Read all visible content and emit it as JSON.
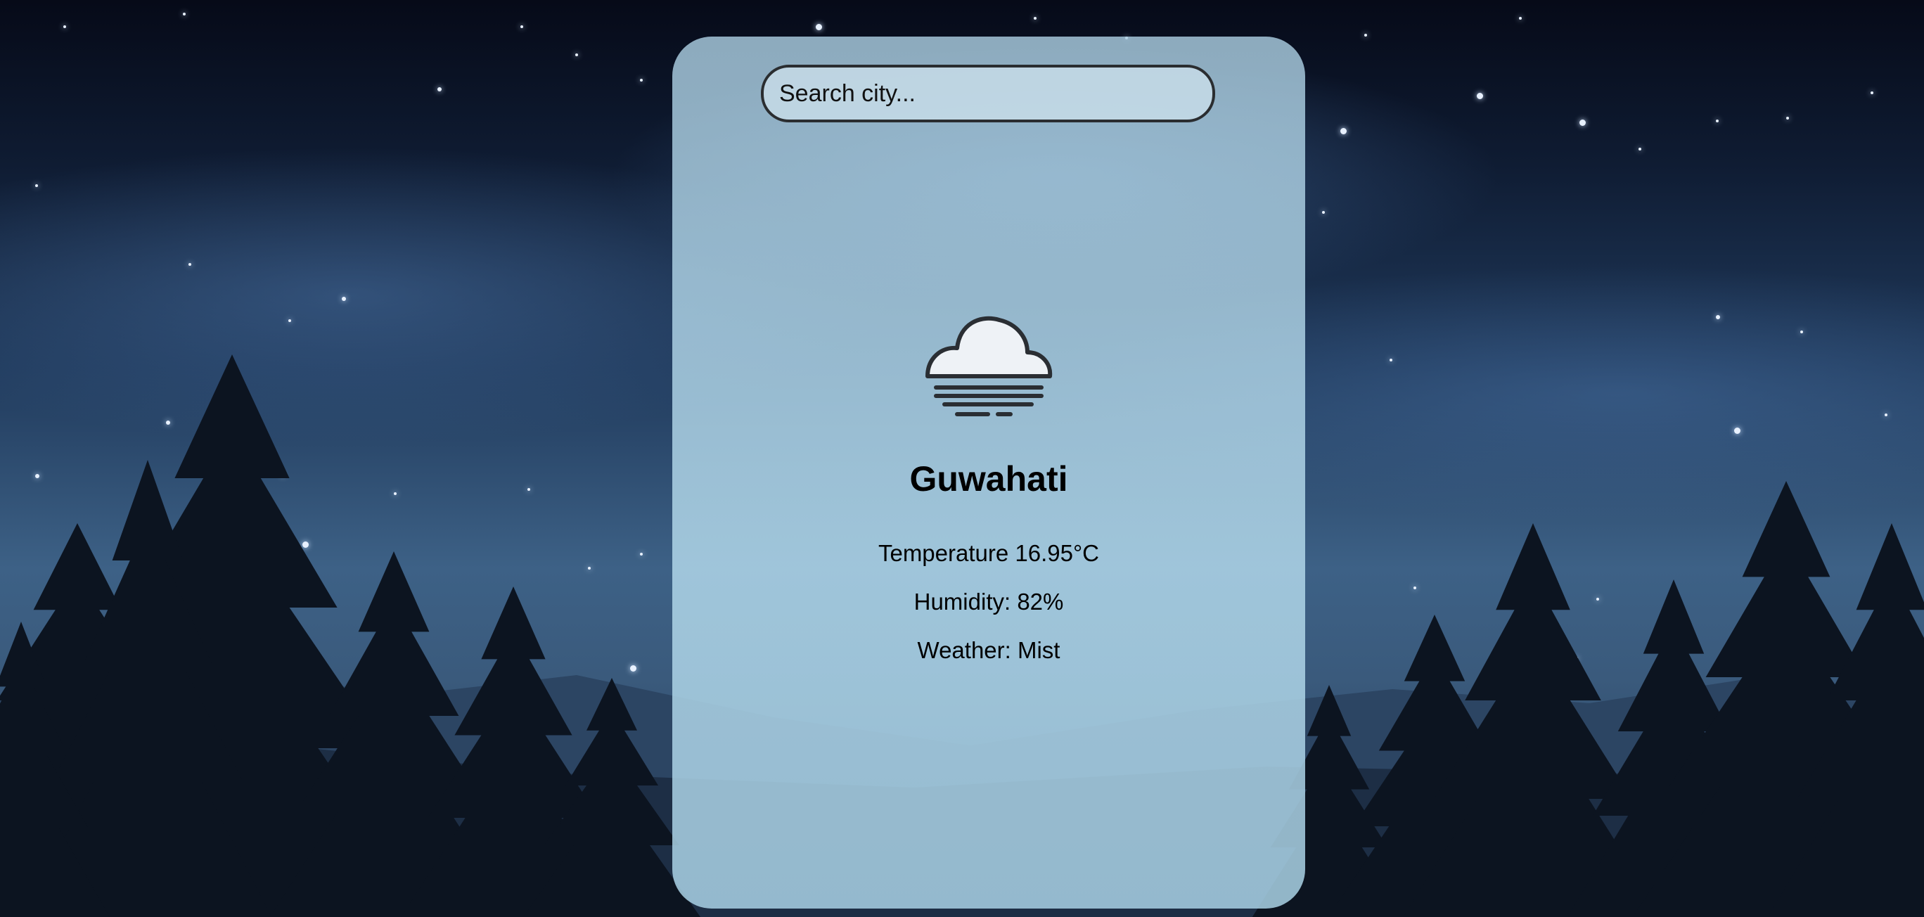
{
  "search": {
    "placeholder": "Search city...",
    "value": ""
  },
  "weather": {
    "icon": "mist-cloud-icon",
    "city": "Guwahati",
    "temperature_text": "Temperature 16.95°C",
    "humidity_text": "Humidity: 82%",
    "condition_text": "Weather: Mist"
  },
  "colors": {
    "card_background": "#acd0e3",
    "search_border": "#2a2d30",
    "sky_top": "#060a18",
    "sky_bottom": "#3d6186"
  }
}
